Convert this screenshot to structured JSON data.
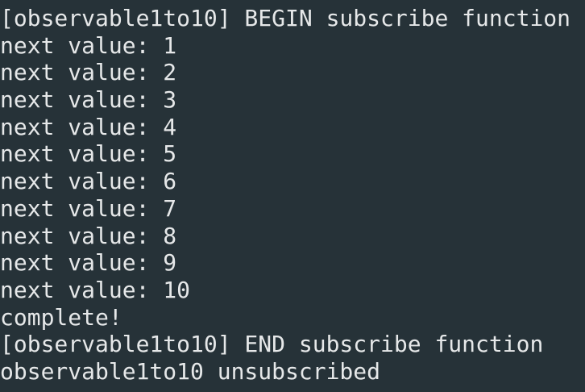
{
  "terminal": {
    "lines": [
      "[observable1to10] BEGIN subscribe function",
      "next value: 1",
      "next value: 2",
      "next value: 3",
      "next value: 4",
      "next value: 5",
      "next value: 6",
      "next value: 7",
      "next value: 8",
      "next value: 9",
      "next value: 10",
      "complete!",
      "[observable1to10] END subscribe function",
      "observable1to10 unsubscribed"
    ],
    "colors": {
      "background": "#263238",
      "text": "#e6e8e9"
    }
  }
}
